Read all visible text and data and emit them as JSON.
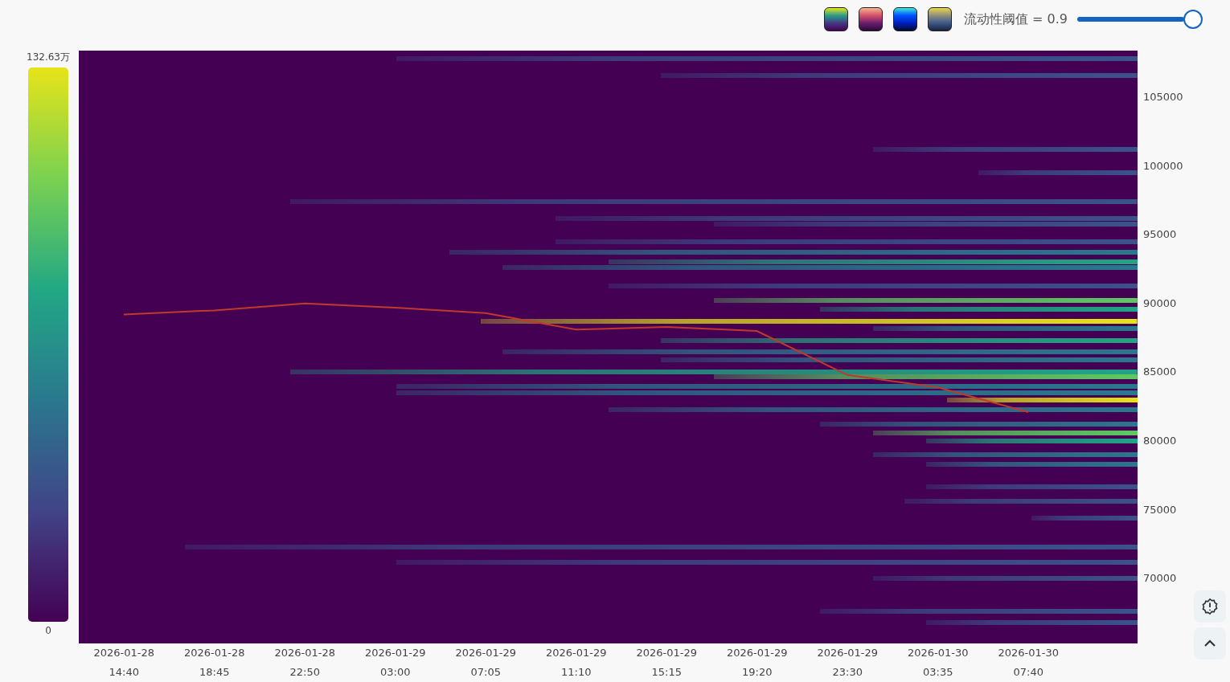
{
  "toolbar": {
    "color_schemes": [
      {
        "kind": "viridis"
      },
      {
        "kind": "magma"
      },
      {
        "kind": "electric"
      },
      {
        "kind": "cividis"
      }
    ],
    "threshold": {
      "label": "流动性阈值 = 0.9",
      "level": 0.9
    }
  },
  "legend": {
    "max": "132.63万",
    "min": "0"
  },
  "chart": {
    "chart_data": {
      "type": "line",
      "x": [
        "2026-01-28 14:40",
        "2026-01-28 18:45",
        "2026-01-28 22:50",
        "2026-01-29 03:00",
        "2026-01-29 07:05",
        "2026-01-29 11:10",
        "2026-01-29 15:15",
        "2026-01-29 19:20",
        "2026-01-29 23:30",
        "2026-01-30 03:35",
        "2026-01-30 07:40"
      ],
      "series": [
        {
          "color": "#c0392b",
          "values": [
            89200,
            89500,
            90000,
            89700,
            89300,
            88100,
            88300,
            88000,
            84800,
            83900,
            82100
          ]
        }
      ],
      "ylim": [
        65280,
        108390
      ],
      "yticks": [
        105000,
        100000,
        95000,
        90000,
        85000,
        80000,
        75000,
        70000
      ]
    }
  },
  "side_buttons": [
    {
      "kind": "alert"
    },
    {
      "kind": "up"
    }
  ]
}
